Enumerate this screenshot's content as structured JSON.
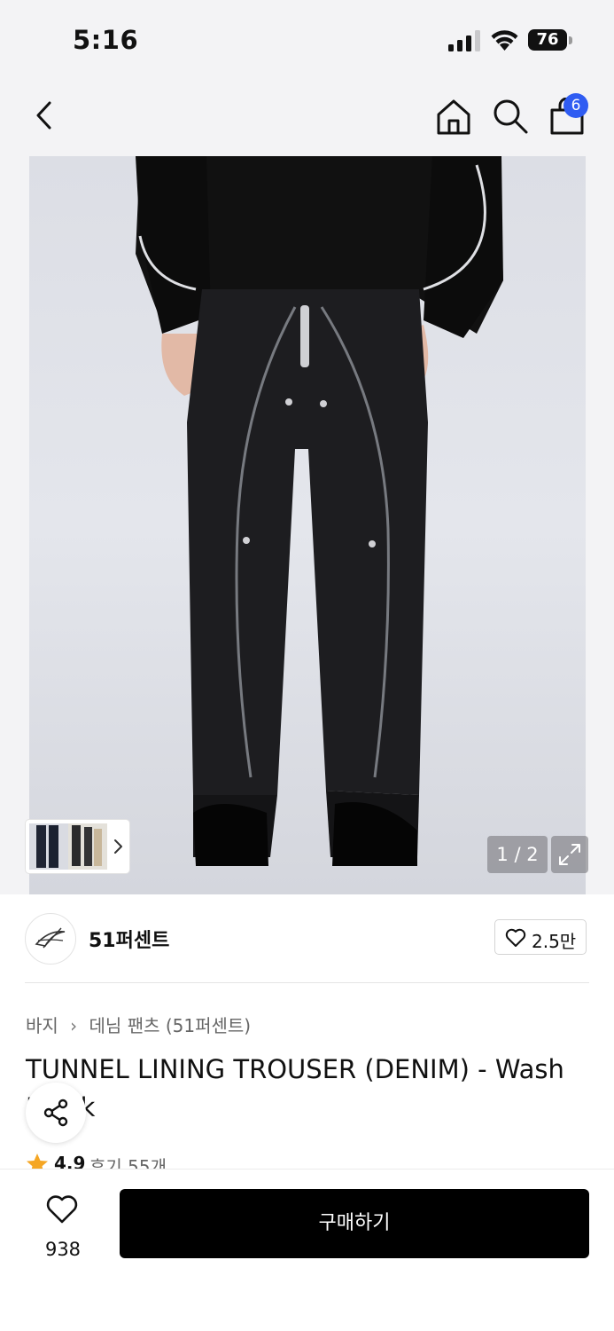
{
  "status_bar": {
    "time": "5:16",
    "battery": "76",
    "icons": [
      "cellular-signal-icon",
      "wifi-icon",
      "battery-icon"
    ]
  },
  "nav": {
    "icons": [
      "chevron-left-icon",
      "home-icon",
      "search-icon",
      "shopping-bag-icon"
    ],
    "cart_count": "6"
  },
  "gallery": {
    "page_counter": "1 / 2",
    "current_page": 1,
    "total_pages": 2,
    "icons": [
      "chevron-right-icon",
      "expand-icon"
    ]
  },
  "brand": {
    "name": "51퍼센트",
    "likes": "2.5만",
    "icons": [
      "heart-outline-icon"
    ]
  },
  "product": {
    "breadcrumb": [
      "바지",
      "데님 팬츠 (51퍼센트)"
    ],
    "title_line1": "TUNNEL LINING TROUSER (DENIM) - Wash",
    "title_line2": "Black",
    "rating": "4.9",
    "review_label": "후기 55개"
  },
  "bottom_bar": {
    "wish_count": "938",
    "buy_label": "구매하기"
  },
  "colors": {
    "badge": "#2f5cf2",
    "buy_button": "#000000",
    "star": "#f5a623",
    "background": "#f3f3f5"
  }
}
